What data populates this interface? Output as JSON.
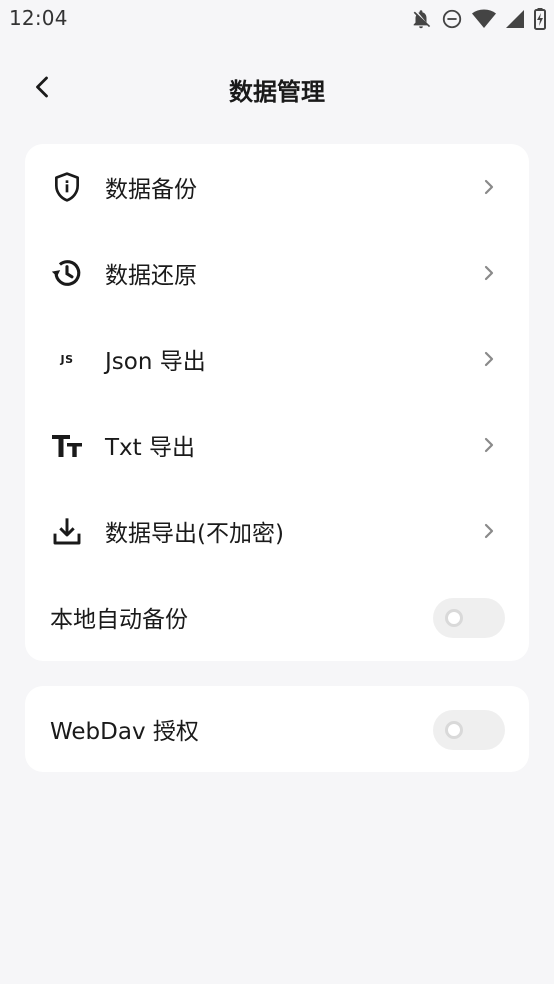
{
  "status_bar": {
    "time": "12:04",
    "icons": [
      "notifications-off-icon",
      "do-not-disturb-icon",
      "wifi-icon",
      "cellular-signal-icon",
      "battery-charging-icon"
    ]
  },
  "header": {
    "title": "数据管理",
    "back_icon": "chevron-left-icon"
  },
  "main_card": {
    "items": [
      {
        "label": "数据备份",
        "icon": "shield-info-icon"
      },
      {
        "label": "数据还原",
        "icon": "history-icon"
      },
      {
        "label": "Json 导出",
        "icon": "js-file-icon",
        "icon_text": "JS"
      },
      {
        "label": "Txt 导出",
        "icon": "text-size-icon"
      },
      {
        "label": "数据导出(不加密)",
        "icon": "download-icon"
      }
    ],
    "auto_backup": {
      "label": "本地自动备份",
      "enabled": false
    }
  },
  "webdav_card": {
    "label": "WebDav 授权",
    "enabled": false
  },
  "colors": {
    "background": "#f6f6f8",
    "card": "#ffffff",
    "text": "#1a1a1a",
    "chevron": "#8a8a8a",
    "toggle_track_off": "#efefef"
  }
}
